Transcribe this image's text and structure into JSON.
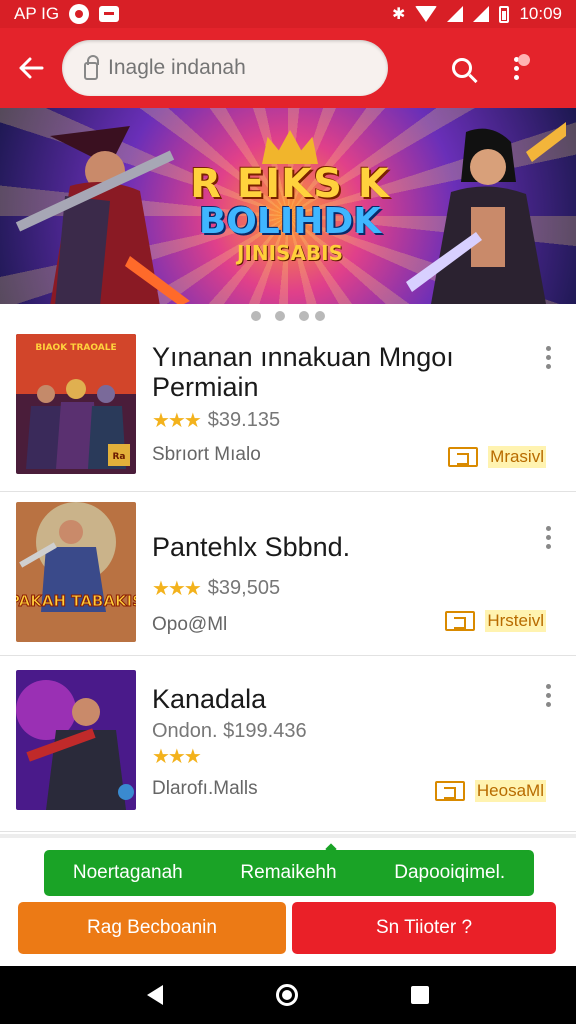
{
  "status_bar": {
    "left_text": "AP IG",
    "time": "10:09"
  },
  "app_bar": {
    "search_placeholder": "Inagle indanah"
  },
  "banner": {
    "line1": "R EIKS K",
    "line2": "BOLIHDK",
    "line3": "JINISABIS",
    "page_count": 4
  },
  "games": [
    {
      "title": "Yınanan ınnakuan Mngoı Permiain",
      "rating": "$39.135",
      "stars": "★★★",
      "sub": "Sbrıort Mıalo",
      "tag": "Mrasivl"
    },
    {
      "title": "Pantehlx Sbbnd.",
      "rating": "$39,505",
      "stars": "★★★",
      "sub": "Opo@Ml",
      "tag": "Hrsteivl"
    },
    {
      "title": "Kanadala",
      "rating": "Ondon. $199.436",
      "stars": "★★★",
      "sub": "Dlarofı.Malls",
      "tag": "HeosaMl"
    }
  ],
  "thumb_art": [
    {
      "caption": "BIAOK TRAOALE",
      "badge": "Ra"
    },
    {
      "caption": "PAKAH TABAKIS",
      "badge": ""
    },
    {
      "caption": "",
      "badge": ""
    }
  ],
  "bottom": {
    "green_items": [
      "Noertaganah",
      "Remaikehh",
      "Dapooiqimel."
    ],
    "orange_button": "Rag Becboanin",
    "red_button": "Sn Tiioter ?"
  },
  "colors": {
    "accent": "#e4232b",
    "green": "#1aa326",
    "orange": "#ec7a15",
    "star": "#f3b21c"
  }
}
